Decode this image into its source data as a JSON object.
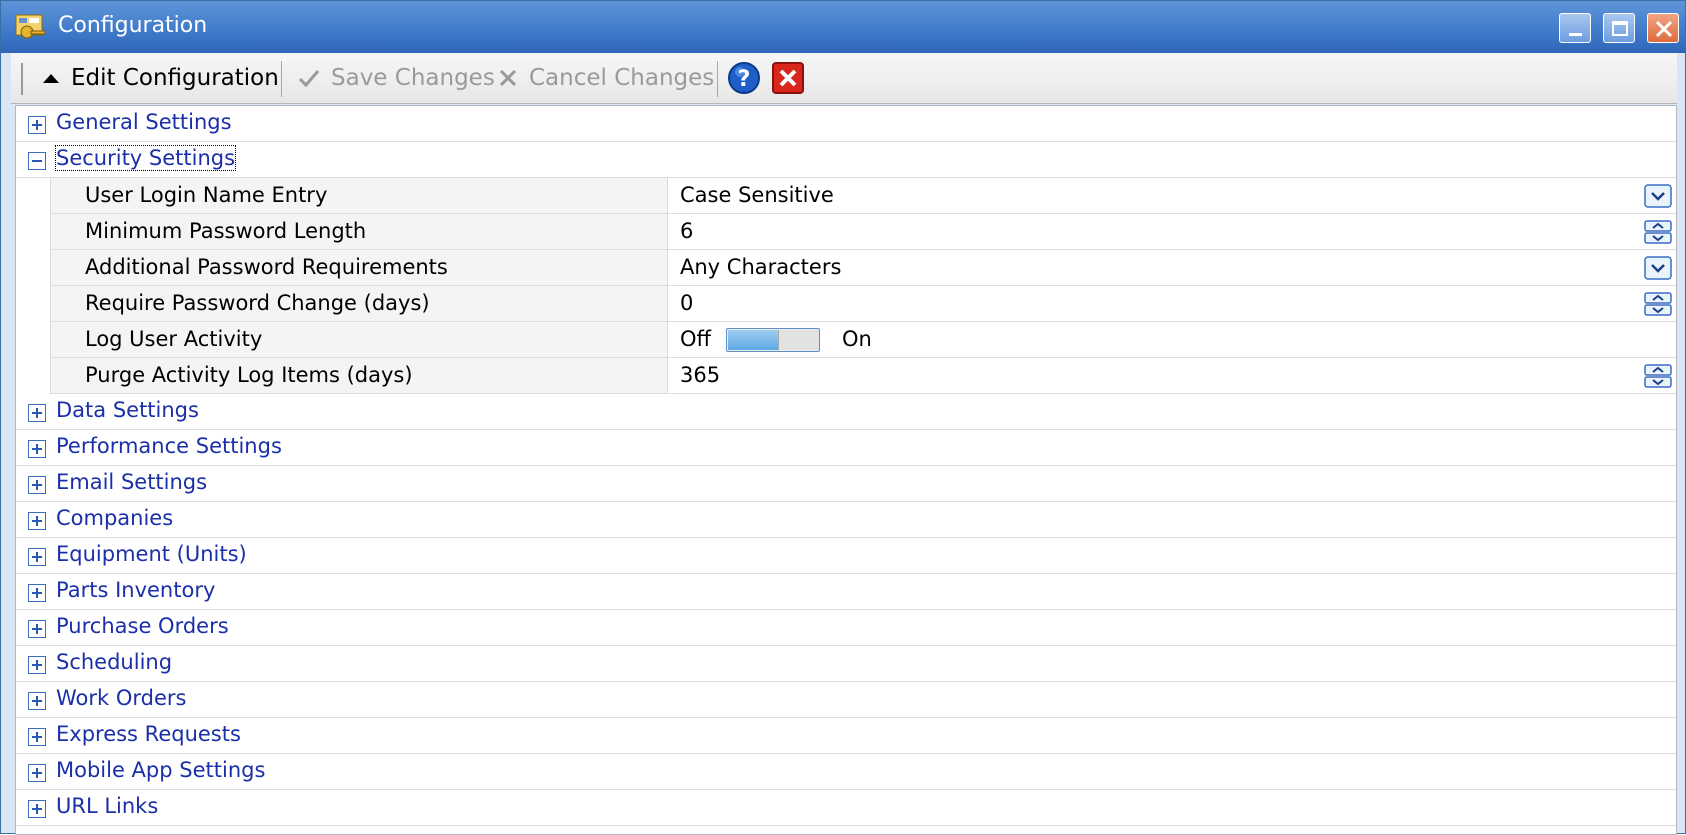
{
  "window": {
    "title": "Configuration",
    "colors": {
      "titlebar": "#3e79c9",
      "group_text": "#1a2fa8",
      "disabled_text": "#9a9a9a"
    }
  },
  "toolbar": {
    "edit_label": "Edit Configuration",
    "save_label": "Save Changes",
    "cancel_label": "Cancel Changes"
  },
  "groups_before": [
    {
      "label": "General Settings",
      "expanded": false
    }
  ],
  "security": {
    "label": "Security Settings",
    "expanded": true,
    "properties": {
      "login_name": {
        "name": "User Login Name Entry",
        "value": "Case Sensitive",
        "control": "dropdown"
      },
      "min_pw_length": {
        "name": "Minimum Password Length",
        "value": "6",
        "control": "spinner"
      },
      "pw_requirements": {
        "name": "Additional Password Requirements",
        "value": "Any Characters",
        "control": "dropdown"
      },
      "pw_change_days": {
        "name": "Require Password Change (days)",
        "value": "0",
        "control": "spinner"
      },
      "log_activity": {
        "name": "Log User Activity",
        "off_label": "Off",
        "on_label": "On",
        "state": "off"
      },
      "purge_days": {
        "name": "Purge Activity Log Items (days)",
        "value": "365",
        "control": "spinner"
      }
    }
  },
  "groups_after": [
    {
      "label": "Data Settings"
    },
    {
      "label": "Performance Settings"
    },
    {
      "label": "Email Settings"
    },
    {
      "label": "Companies"
    },
    {
      "label": "Equipment (Units)"
    },
    {
      "label": "Parts Inventory"
    },
    {
      "label": "Purchase Orders"
    },
    {
      "label": "Scheduling"
    },
    {
      "label": "Work Orders"
    },
    {
      "label": "Express Requests"
    },
    {
      "label": "Mobile App Settings"
    },
    {
      "label": "URL Links"
    }
  ]
}
